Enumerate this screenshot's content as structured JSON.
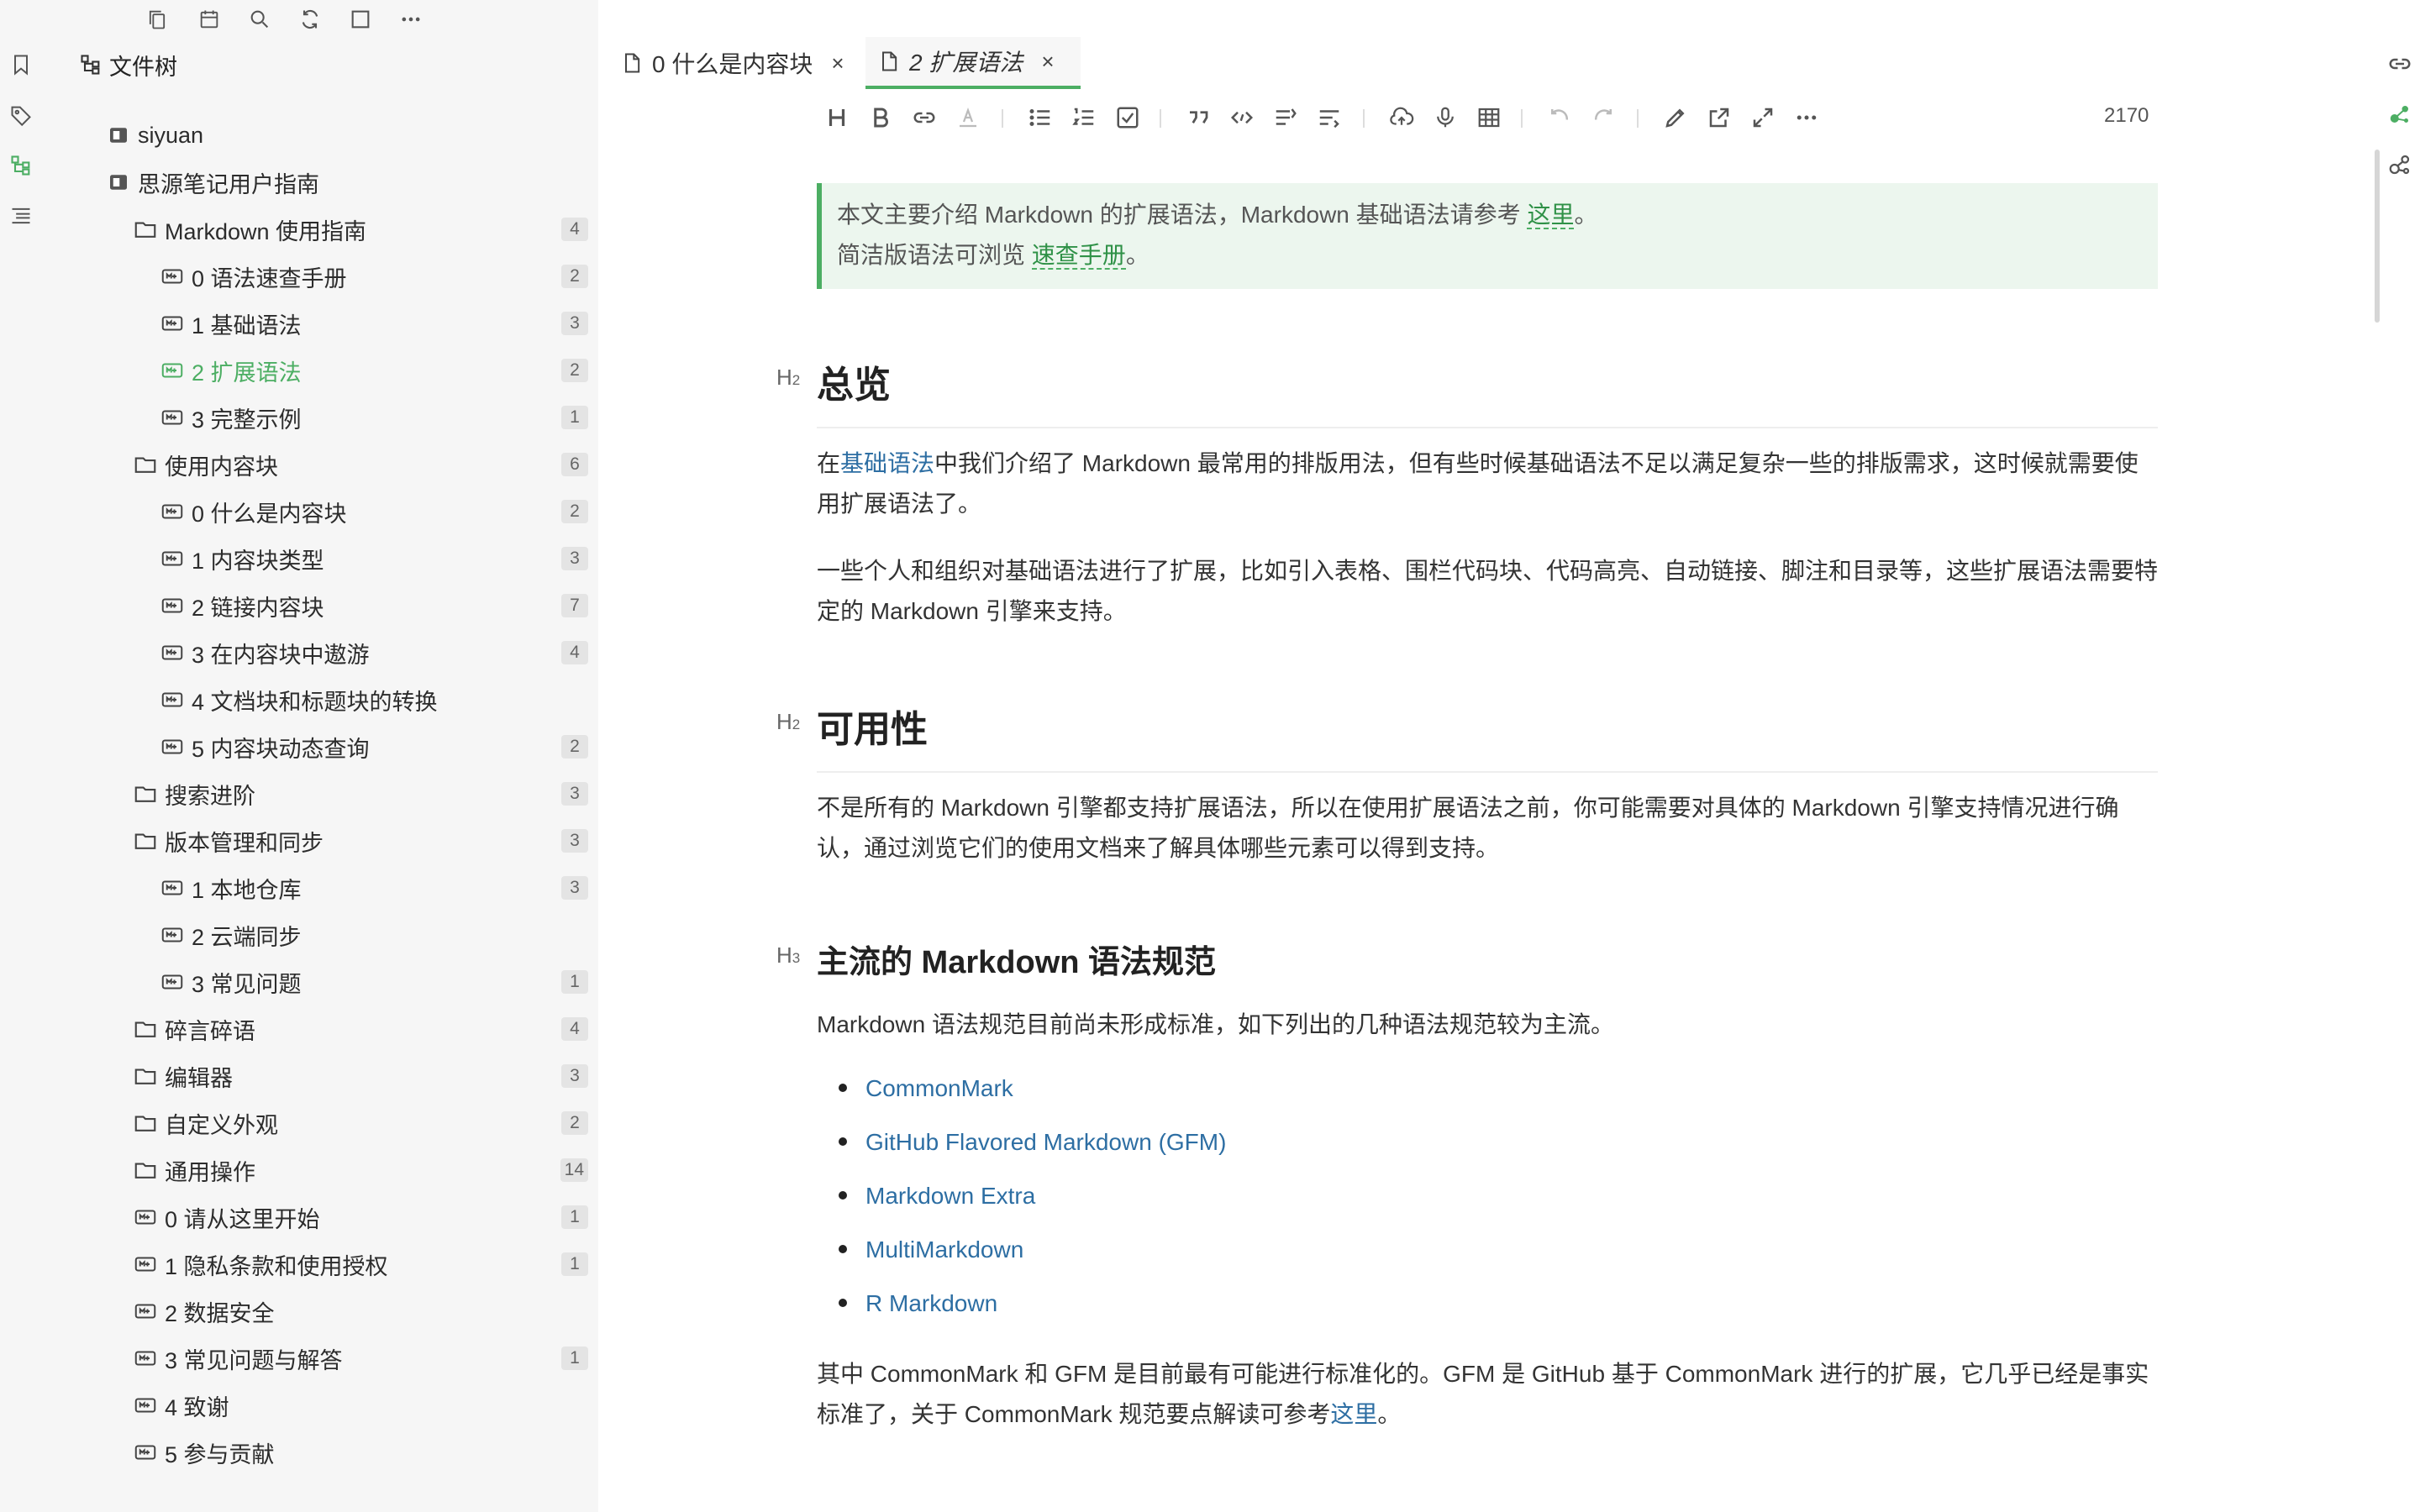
{
  "tree": {
    "title": "文件树",
    "items": [
      {
        "label": "siyuan",
        "count": "",
        "level": 1,
        "type": "notebook"
      },
      {
        "label": "思源笔记用户指南",
        "count": "",
        "level": 1,
        "type": "notebook"
      },
      {
        "label": "Markdown 使用指南",
        "count": "4",
        "level": 2,
        "type": "folder"
      },
      {
        "label": "0 语法速查手册",
        "count": "2",
        "level": 3,
        "type": "doc"
      },
      {
        "label": "1 基础语法",
        "count": "3",
        "level": 3,
        "type": "doc"
      },
      {
        "label": "2 扩展语法",
        "count": "2",
        "level": 3,
        "type": "doc",
        "active": true
      },
      {
        "label": "3 完整示例",
        "count": "1",
        "level": 3,
        "type": "doc"
      },
      {
        "label": "使用内容块",
        "count": "6",
        "level": 2,
        "type": "folder"
      },
      {
        "label": "0 什么是内容块",
        "count": "2",
        "level": 3,
        "type": "doc"
      },
      {
        "label": "1 内容块类型",
        "count": "3",
        "level": 3,
        "type": "doc"
      },
      {
        "label": "2 链接内容块",
        "count": "7",
        "level": 3,
        "type": "doc"
      },
      {
        "label": "3 在内容块中遨游",
        "count": "4",
        "level": 3,
        "type": "doc"
      },
      {
        "label": "4 文档块和标题块的转换",
        "count": "",
        "level": 3,
        "type": "doc"
      },
      {
        "label": "5 内容块动态查询",
        "count": "2",
        "level": 3,
        "type": "doc"
      },
      {
        "label": "搜索进阶",
        "count": "3",
        "level": 2,
        "type": "folder"
      },
      {
        "label": "版本管理和同步",
        "count": "3",
        "level": 2,
        "type": "folder"
      },
      {
        "label": "1 本地仓库",
        "count": "3",
        "level": 3,
        "type": "doc"
      },
      {
        "label": "2 云端同步",
        "count": "",
        "level": 3,
        "type": "doc"
      },
      {
        "label": "3 常见问题",
        "count": "1",
        "level": 3,
        "type": "doc"
      },
      {
        "label": "碎言碎语",
        "count": "4",
        "level": 2,
        "type": "folder"
      },
      {
        "label": "编辑器",
        "count": "3",
        "level": 2,
        "type": "folder"
      },
      {
        "label": "自定义外观",
        "count": "2",
        "level": 2,
        "type": "folder"
      },
      {
        "label": "通用操作",
        "count": "14",
        "level": 2,
        "type": "folder"
      },
      {
        "label": "0 请从这里开始",
        "count": "1",
        "level": 2,
        "type": "doc"
      },
      {
        "label": "1 隐私条款和使用授权",
        "count": "1",
        "level": 2,
        "type": "doc"
      },
      {
        "label": "2 数据安全",
        "count": "",
        "level": 2,
        "type": "doc"
      },
      {
        "label": "3 常见问题与解答",
        "count": "1",
        "level": 2,
        "type": "doc"
      },
      {
        "label": "4 致谢",
        "count": "",
        "level": 2,
        "type": "doc"
      },
      {
        "label": "5 参与贡献",
        "count": "",
        "level": 2,
        "type": "doc"
      }
    ]
  },
  "tabs": [
    {
      "label": "0 什么是内容块",
      "close": "×"
    },
    {
      "label": "2 扩展语法",
      "close": "×"
    }
  ],
  "toolbar": {
    "word_count": "2170",
    "buttons": [
      "heading-icon",
      "bold-icon",
      "link-icon",
      "font-color-icon",
      "bullet-list-icon",
      "ordered-list-icon",
      "checklist-icon",
      "quote-icon",
      "inline-code-icon",
      "code-block-icon",
      "indent-icon",
      "upload-icon",
      "microphone-icon",
      "table-icon",
      "undo-icon",
      "redo-icon",
      "edit-icon",
      "open-external-icon",
      "fullscreen-icon",
      "more-icon"
    ]
  },
  "doc": {
    "callout": {
      "line1": "本文主要介绍 Markdown 的扩展语法，Markdown 基础语法请参考",
      "line1_link": "这里",
      "line1_end": "。",
      "line2": "简洁版语法可浏览",
      "line2_link": "速查手册",
      "line2_end": "。"
    },
    "h_overview": {
      "tag": "H",
      "level": "2",
      "text": "总览"
    },
    "p1_link": "基础语法",
    "p1_pre": "在",
    "p1_rest": "中我们介绍了 Markdown 最常用的排版用法，但有些时候基础语法不足以满足复杂一些的排版需求，这时候就需要使用扩展语法了。",
    "p2": "一些个人和组织对基础语法进行了扩展，比如引入表格、围栏代码块、代码高亮、自动链接、脚注和目录等，这些扩展语法需要特定的 Markdown 引擎来支持。",
    "h_avail": {
      "tag": "H",
      "level": "2",
      "text": "可用性"
    },
    "p3": "不是所有的 Markdown 引擎都支持扩展语法，所以在使用扩展语法之前，你可能需要对具体的 Markdown 引擎支持情况进行确认，通过浏览它们的使用文档来了解具体哪些元素可以得到支持。",
    "h_mainstream": {
      "tag": "H",
      "level": "3",
      "text": "主流的 Markdown 语法规范"
    },
    "p4": "Markdown 语法规范目前尚未形成标准，如下列出的几种语法规范较为主流。",
    "bullets": [
      "CommonMark",
      "GitHub Flavored Markdown (GFM)",
      "Markdown Extra",
      "MultiMarkdown",
      "R Markdown"
    ],
    "p5": "其中 CommonMark 和 GFM 是目前最有可能进行标准化的。GFM 是 GitHub 基于 CommonMark 进行的扩展，它几乎已经是事实标准了，关于 CommonMark 规范要点解读可参考",
    "p5_link": "这里",
    "p5_end": "。"
  },
  "colors": {
    "accent": "#4cae63",
    "link": "#2d6ea3",
    "callout_bg": "#ecf6ee"
  }
}
